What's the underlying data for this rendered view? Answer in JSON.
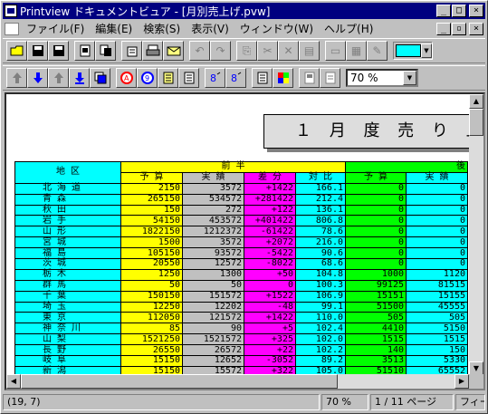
{
  "window": {
    "title": "Printview ドキュメントビュア - [月別売上げ.pvw]",
    "minimize": "_",
    "maximize": "□",
    "close": "×"
  },
  "menu": {
    "items": [
      "ファイル(F)",
      "編集(E)",
      "検索(S)",
      "表示(V)",
      "ウィンドウ(W)",
      "ヘルプ(H)"
    ],
    "doc_min": "_",
    "doc_restore": "▫",
    "doc_close": "×"
  },
  "toolbar1": {
    "color_swatch": "#00ffff"
  },
  "toolbar2": {
    "zoom_value": "70 %"
  },
  "report": {
    "title": "１ 月 度 売 り 上 げ 集",
    "header": {
      "region": "地 区",
      "first_half": "前 半",
      "second_half": "後",
      "budget": "予 算",
      "actual": "実 績",
      "diff": "差 分",
      "ratio": "対 比",
      "budget2": "予 算",
      "actual2": "実 績"
    },
    "rows": [
      {
        "region": "北 海 道",
        "budget": "2150",
        "actual": "3572",
        "diff": "+1422",
        "ratio": "166.1",
        "budget2": "0",
        "actual2": "0"
      },
      {
        "region": "青 森",
        "budget": "265150",
        "actual": "534572",
        "diff": "+281422",
        "ratio": "212.4",
        "budget2": "0",
        "actual2": "0"
      },
      {
        "region": "秋 田",
        "budget": "150",
        "actual": "272",
        "diff": "+122",
        "ratio": "136.1",
        "budget2": "0",
        "actual2": "0"
      },
      {
        "region": "岩 手",
        "budget": "54150",
        "actual": "453572",
        "diff": "+401422",
        "ratio": "806.8",
        "budget2": "0",
        "actual2": "0"
      },
      {
        "region": "山 形",
        "budget": "1822150",
        "actual": "1212372",
        "diff": "-61422",
        "ratio": "78.6",
        "budget2": "0",
        "actual2": "0"
      },
      {
        "region": "宮 城",
        "budget": "1500",
        "actual": "3572",
        "diff": "+2072",
        "ratio": "216.0",
        "budget2": "0",
        "actual2": "0"
      },
      {
        "region": "福 島",
        "budget": "105150",
        "actual": "93572",
        "diff": "-5422",
        "ratio": "90.6",
        "budget2": "0",
        "actual2": "0"
      },
      {
        "region": "茨 城",
        "budget": "20550",
        "actual": "12572",
        "diff": "-8022",
        "ratio": "68.6",
        "budget2": "0",
        "actual2": "0"
      },
      {
        "region": "栃 木",
        "budget": "1250",
        "actual": "1300",
        "diff": "+50",
        "ratio": "104.8",
        "budget2": "1000",
        "actual2": "1120"
      },
      {
        "region": "群 馬",
        "budget": "50",
        "actual": "50",
        "diff": "0",
        "ratio": "100.3",
        "budget2": "99125",
        "actual2": "81515"
      },
      {
        "region": "千 葉",
        "budget": "150150",
        "actual": "151572",
        "diff": "+1522",
        "ratio": "106.9",
        "budget2": "15151",
        "actual2": "15155"
      },
      {
        "region": "埼 玉",
        "budget": "12250",
        "actual": "12202",
        "diff": "-48",
        "ratio": "99.1",
        "budget2": "51500",
        "actual2": "45555"
      },
      {
        "region": "東 京",
        "budget": "112050",
        "actual": "121572",
        "diff": "+1422",
        "ratio": "110.0",
        "budget2": "505",
        "actual2": "505"
      },
      {
        "region": "神 奈 川",
        "budget": "85",
        "actual": "90",
        "diff": "+5",
        "ratio": "102.4",
        "budget2": "4410",
        "actual2": "5150"
      },
      {
        "region": "山 梨",
        "budget": "1521250",
        "actual": "1521572",
        "diff": "+325",
        "ratio": "102.0",
        "budget2": "1515",
        "actual2": "1515"
      },
      {
        "region": "長 野",
        "budget": "26550",
        "actual": "26572",
        "diff": "+22",
        "ratio": "102.2",
        "budget2": "140",
        "actual2": "150"
      },
      {
        "region": "岐 阜",
        "budget": "15150",
        "actual": "12652",
        "diff": "-3052",
        "ratio": "89.2",
        "budget2": "3513",
        "actual2": "5330"
      },
      {
        "region": "新 潟",
        "budget": "15150",
        "actual": "15572",
        "diff": "+322",
        "ratio": "105.0",
        "budget2": "51510",
        "actual2": "65552"
      }
    ]
  },
  "statusbar": {
    "position": "(19, 7)",
    "zoom": "70 %",
    "page": "1 / 11 ページ",
    "extra": "フィー"
  }
}
